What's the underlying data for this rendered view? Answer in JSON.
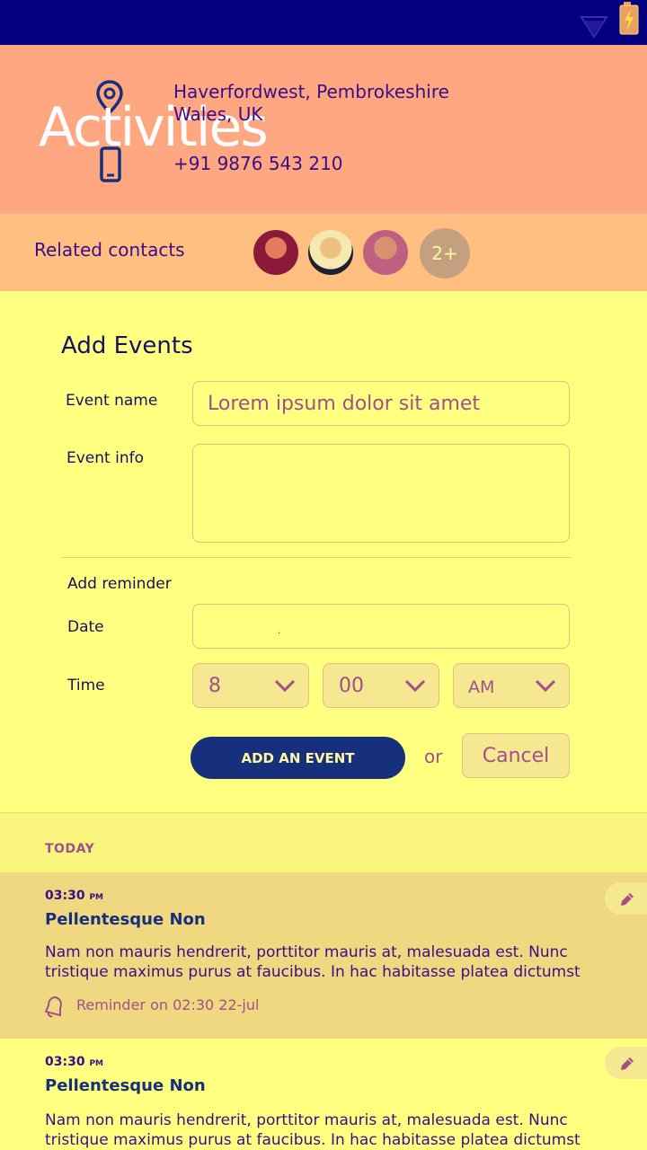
{
  "screen": {
    "title": "Activities"
  },
  "contact": {
    "address_line1": "Haverfordwest, Pembrokeshire",
    "address_line2": "Wales, UK",
    "phone": "+91 9876 543 210"
  },
  "related": {
    "label": "Related contacts",
    "more_count": "2+"
  },
  "form": {
    "title": "Add Events",
    "event_name_label": "Event name",
    "event_name_value": "Lorem ipsum dolor sit amet",
    "event_info_label": "Event info",
    "event_info_value": "",
    "reminder_heading": "Add reminder",
    "date_label": "Date",
    "date_value": ".",
    "time_label": "Time",
    "hour": "8",
    "minute": "00",
    "period": "AM",
    "add_button": "ADD AN EVENT",
    "or_text": "or",
    "cancel_button": "Cancel"
  },
  "today_label": "TODAY",
  "activities": [
    {
      "time": "03:30",
      "meridiem": "PM",
      "title": "Pellentesque Non",
      "body": "Nam non mauris hendrerit, porttitor mauris at, malesuada est. Nunc tristique maximus purus at faucibus. In hac habitasse platea dictumst",
      "reminder": "Reminder on 02:30 22-jul"
    },
    {
      "time": "03:30",
      "meridiem": "PM",
      "title": "Pellentesque Non",
      "body": "Nam non mauris hendrerit, porttitor mauris at, malesuada est. Nunc tristique maximus purus at faucibus. In hac habitasse platea dictumst"
    }
  ],
  "colors": {
    "status_bar": "#02007e",
    "header": "#ffa780",
    "contacts_bar": "#ffbf80",
    "page": "#ffff80",
    "primary_button": "#17307e"
  },
  "icons": [
    "wifi-icon",
    "battery-icon",
    "location-pin-icon",
    "phone-icon",
    "chevron-down-icon",
    "bell-icon",
    "pencil-icon"
  ]
}
